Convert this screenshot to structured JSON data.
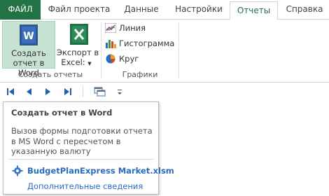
{
  "tabs": [
    {
      "label": "ФАЙЛ"
    },
    {
      "label": "Файл проекта"
    },
    {
      "label": "Данные"
    },
    {
      "label": "Настройки"
    },
    {
      "label": "Отчеты",
      "active": true
    },
    {
      "label": "Справка"
    }
  ],
  "ribbon": {
    "groups": {
      "create": {
        "label": "Создать отчеты",
        "word_button": {
          "line1": "Создать",
          "line2": "отчет в Word"
        },
        "excel_button": {
          "line1": "Экспорт в",
          "line2": "Excel:"
        }
      },
      "charts": {
        "label": "Графики",
        "items": [
          {
            "label": "Линия",
            "icon": "line-chart-icon"
          },
          {
            "label": "Гистограмма",
            "icon": "bar-chart-icon"
          },
          {
            "label": "Круг",
            "icon": "pie-chart-icon"
          }
        ]
      }
    }
  },
  "tooltip": {
    "title": "Создать отчет в Word",
    "description": "Вызов формы подготовки отчета в MS Word с пересчетом в указанную валюту",
    "file": "BudgetPlanExpress Market.xlsm",
    "more": "Дополнительные сведения"
  },
  "colors": {
    "file_tab": "#217346",
    "active_tab_text": "#217346",
    "selected_button": "#c5e3d0",
    "link": "#2a6cc0",
    "nav_arrows": "#1e5fb4"
  }
}
